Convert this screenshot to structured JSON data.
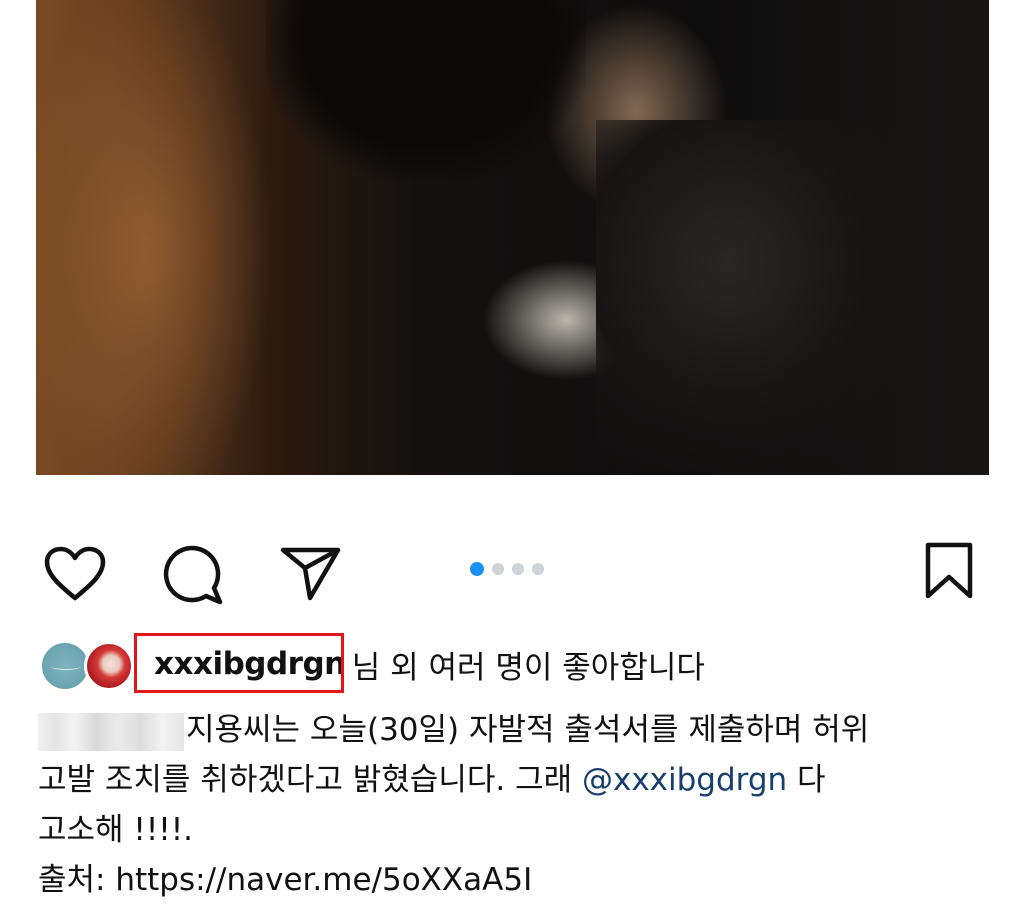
{
  "post": {
    "photo_alt": "post photo"
  },
  "actions": {
    "like_icon": "heart-icon",
    "comment_icon": "comment-icon",
    "share_icon": "send-icon",
    "save_icon": "bookmark-icon",
    "carousel": {
      "total": 4,
      "active_index": 0
    }
  },
  "likes": {
    "username": "xxxibgdrgn",
    "suffix": "님 외 여러 명이 좋아합니다"
  },
  "caption": {
    "line1_text": "지용씨는 오늘(30일) 자발적 출석서를 제출하며 허위",
    "line2_pre": "고발 조치를 취하겠다고 밝혔습니다. 그래 ",
    "line2_mention": "@xxxibgdrgn",
    "line2_post": " 다",
    "line3": "고소해 !!!!.",
    "line4": "출처: https://naver.me/5oXXaA5I"
  },
  "colors": {
    "accent": "#1a90f0",
    "highlight": "#e3141a",
    "mention": "#163e6e"
  }
}
